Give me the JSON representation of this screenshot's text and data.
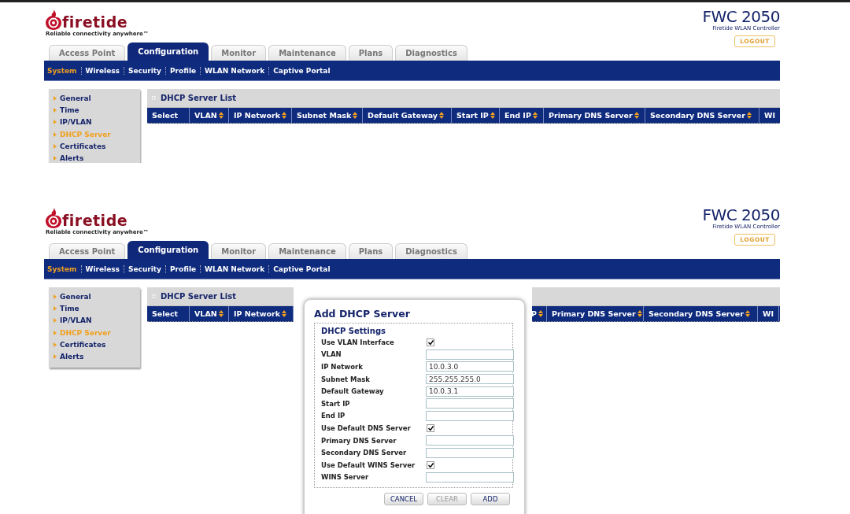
{
  "screens": [
    {
      "brand": {
        "name": "firetide",
        "tagline": "Reliable connectivity anywhere™"
      },
      "product": {
        "model": "FWC 2050",
        "subtitle": "Firetide WLAN Controller",
        "logout": "LOGOUT"
      },
      "tabs": [
        {
          "label": "Access Point",
          "selected": false
        },
        {
          "label": "Configuration",
          "selected": true
        },
        {
          "label": "Monitor",
          "selected": false
        },
        {
          "label": "Maintenance",
          "selected": false
        },
        {
          "label": "Plans",
          "selected": false
        },
        {
          "label": "Diagnostics",
          "selected": false
        }
      ],
      "subnav": [
        {
          "label": "System",
          "selected": true
        },
        {
          "label": "Wireless",
          "selected": false
        },
        {
          "label": "Security",
          "selected": false
        },
        {
          "label": "Profile",
          "selected": false
        },
        {
          "label": "WLAN Network",
          "selected": false
        },
        {
          "label": "Captive Portal",
          "selected": false
        }
      ],
      "sidebar": [
        {
          "label": "General",
          "selected": false
        },
        {
          "label": "Time",
          "selected": false
        },
        {
          "label": "IP/VLAN",
          "selected": false
        },
        {
          "label": "DHCP Server",
          "selected": true
        },
        {
          "label": "Certificates",
          "selected": false
        },
        {
          "label": "Alerts",
          "selected": false
        }
      ],
      "list": {
        "title": "DHCP Server List",
        "columns": [
          {
            "label": "Select",
            "sortable": false
          },
          {
            "label": "VLAN",
            "sortable": true
          },
          {
            "label": "IP Network",
            "sortable": true
          },
          {
            "label": "Subnet Mask",
            "sortable": true
          },
          {
            "label": "Default Gateway",
            "sortable": true
          },
          {
            "label": "Start IP",
            "sortable": true
          },
          {
            "label": "End IP",
            "sortable": true
          },
          {
            "label": "Primary DNS Server",
            "sortable": true
          },
          {
            "label": "Secondary DNS Server",
            "sortable": true
          },
          {
            "label": "WI",
            "sortable": false
          }
        ]
      }
    },
    {
      "brand": {
        "name": "firetide",
        "tagline": "Reliable connectivity anywhere™"
      },
      "product": {
        "model": "FWC 2050",
        "subtitle": "Firetide WLAN Controller",
        "logout": "LOGOUT"
      },
      "tabs": [
        {
          "label": "Access Point",
          "selected": false
        },
        {
          "label": "Configuration",
          "selected": true
        },
        {
          "label": "Monitor",
          "selected": false
        },
        {
          "label": "Maintenance",
          "selected": false
        },
        {
          "label": "Plans",
          "selected": false
        },
        {
          "label": "Diagnostics",
          "selected": false
        }
      ],
      "subnav": [
        {
          "label": "System",
          "selected": true
        },
        {
          "label": "Wireless",
          "selected": false
        },
        {
          "label": "Security",
          "selected": false
        },
        {
          "label": "Profile",
          "selected": false
        },
        {
          "label": "WLAN Network",
          "selected": false
        },
        {
          "label": "Captive Portal",
          "selected": false
        }
      ],
      "sidebar": [
        {
          "label": "General",
          "selected": false
        },
        {
          "label": "Time",
          "selected": false
        },
        {
          "label": "IP/VLAN",
          "selected": false
        },
        {
          "label": "DHCP Server",
          "selected": true
        },
        {
          "label": "Certificates",
          "selected": false
        },
        {
          "label": "Alerts",
          "selected": false
        }
      ],
      "list": {
        "title": "DHCP Server List",
        "columns": [
          {
            "label": "Select",
            "sortable": false
          },
          {
            "label": "VLAN",
            "sortable": true
          },
          {
            "label": "IP Network",
            "sortable": true
          },
          {
            "label": "P",
            "sortable": true
          },
          {
            "label": "Primary DNS Server",
            "sortable": true
          },
          {
            "label": "Secondary DNS Server",
            "sortable": true
          },
          {
            "label": "WI",
            "sortable": false
          }
        ]
      },
      "dialog": {
        "title": "Add DHCP Server",
        "section": "DHCP Settings",
        "fields": [
          {
            "label": "Use VLAN Interface",
            "kind": "checkbox",
            "checked": true
          },
          {
            "label": "VLAN",
            "kind": "text"
          },
          {
            "label": "IP Network",
            "kind": "text",
            "value": "10.0.3.0"
          },
          {
            "label": "Subnet Mask",
            "kind": "text",
            "value": "255.255.255.0"
          },
          {
            "label": "Default Gateway",
            "kind": "text",
            "value": "10.0.3.1"
          },
          {
            "label": "Start IP",
            "kind": "text"
          },
          {
            "label": "End IP",
            "kind": "text"
          },
          {
            "label": "Use Default DNS Server",
            "kind": "checkbox",
            "checked": true
          },
          {
            "label": "Primary DNS Server",
            "kind": "text"
          },
          {
            "label": "Secondary DNS Server",
            "kind": "text"
          },
          {
            "label": "Use Default WINS Server",
            "kind": "checkbox",
            "checked": true
          },
          {
            "label": "WINS Server",
            "kind": "text"
          }
        ],
        "buttons": [
          {
            "label": "CANCEL",
            "disabled": false
          },
          {
            "label": "CLEAR",
            "disabled": true
          },
          {
            "label": "ADD",
            "disabled": false
          }
        ]
      }
    }
  ]
}
